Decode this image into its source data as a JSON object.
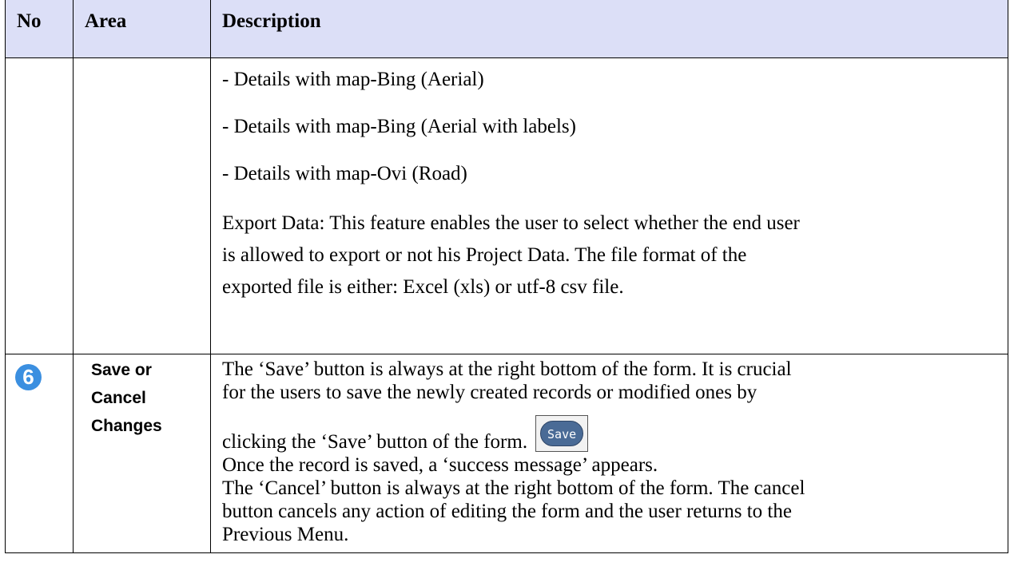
{
  "header": {
    "no": "No",
    "area": "Area",
    "description": "Description"
  },
  "row1": {
    "lines": [
      "- Details with map-Bing (Aerial)",
      "- Details with map-Bing (Aerial with labels)",
      "- Details with map-Ovi (Road)"
    ],
    "export_line1": "Export Data: This feature enables the user to select whether the end user",
    "export_line2": "is allowed to export or not his Project Data. The file format of the",
    "export_line3": "exported file is either: Excel (xls) or utf-8 csv file."
  },
  "row2": {
    "number": "6",
    "area_line1": "Save or",
    "area_line2": "Cancel",
    "area_line3": "Changes",
    "line1": "The ‘Save’ button is always at the right bottom of the form. It is crucial",
    "line2": "for the users to save the newly created records or modified ones by",
    "line3": "clicking the ‘Save’ button of the form.",
    "save_button_label": "Save",
    "line4": "Once the record is saved, a ‘success message’ appears.",
    "line5": "The ‘Cancel’ button is always at the right bottom of the form. The cancel",
    "line6": "button cancels any action of editing the form and the user returns to the",
    "line7": "Previous Menu."
  }
}
